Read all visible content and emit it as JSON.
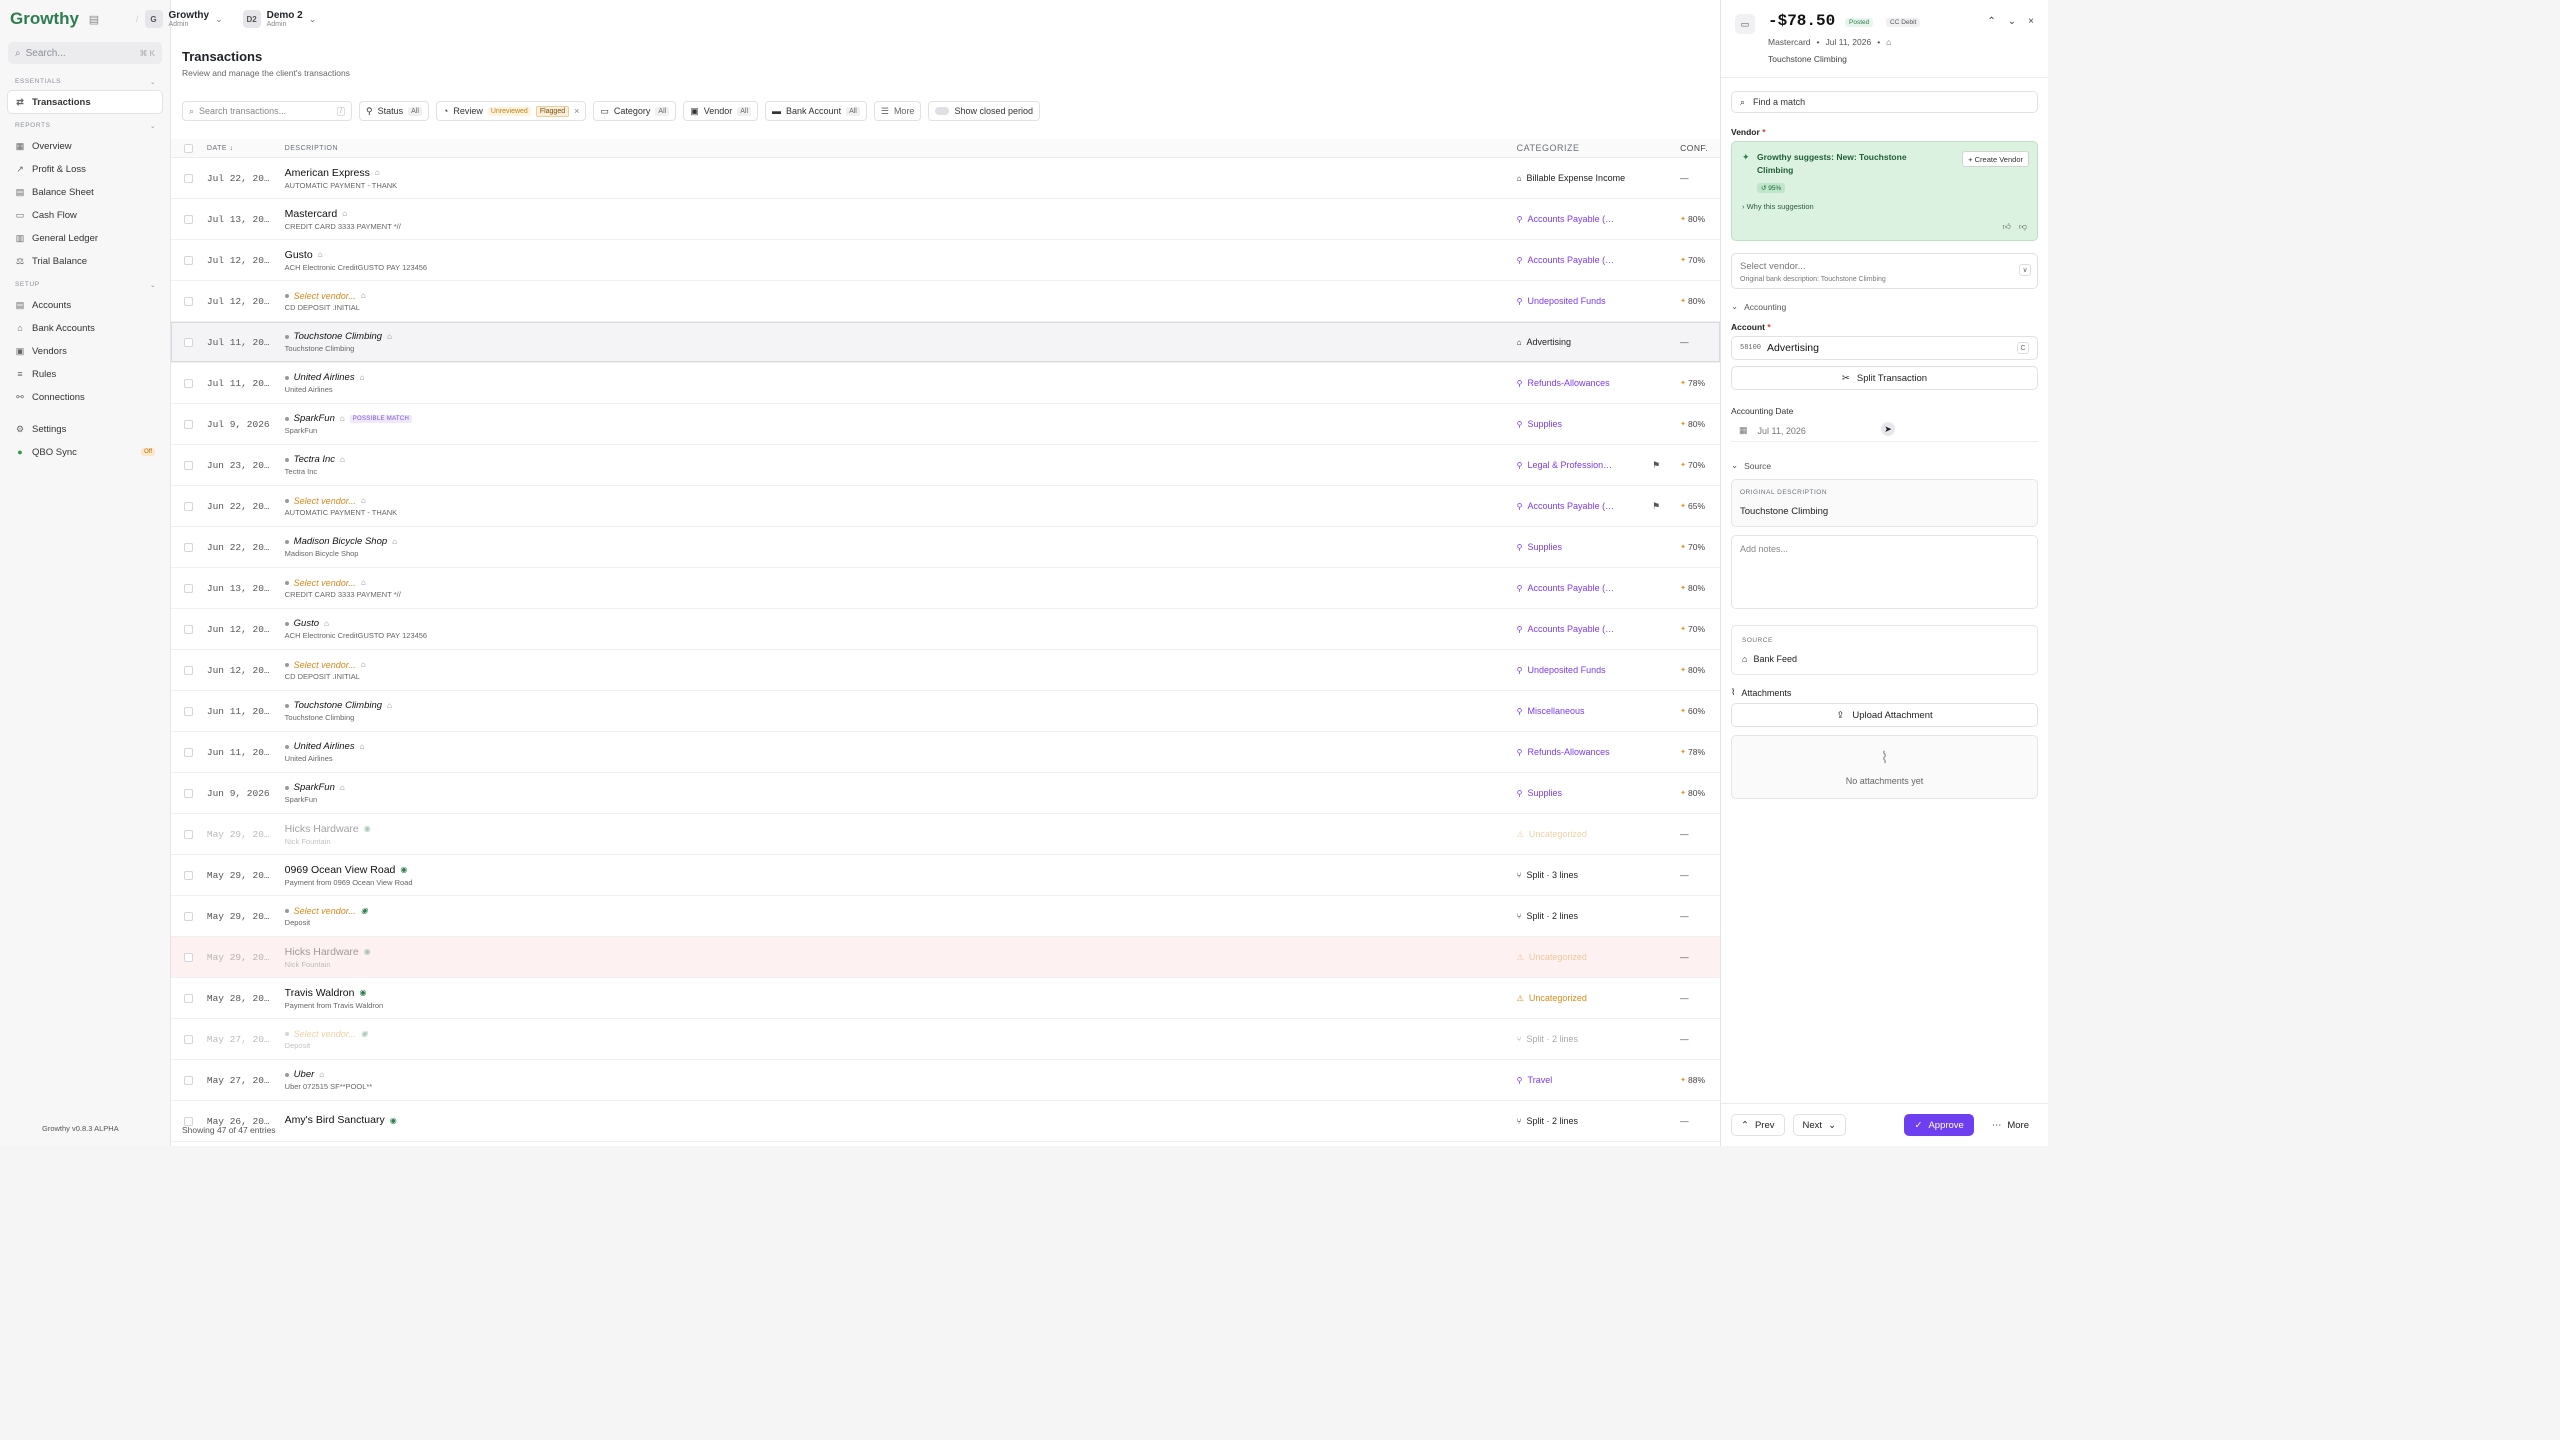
{
  "sidebar": {
    "logo": "Growthy",
    "search_placeholder": "Search...",
    "search_kbd": "⌘ K",
    "essentials_label": "ESSENTIALS",
    "reports_label": "REPORTS",
    "setup_label": "SETUP",
    "essentials": [
      {
        "label": "Transactions",
        "icon": "arrows-icon"
      }
    ],
    "reports": [
      {
        "label": "Overview"
      },
      {
        "label": "Profit & Loss"
      },
      {
        "label": "Balance Sheet"
      },
      {
        "label": "Cash Flow"
      },
      {
        "label": "General Ledger"
      },
      {
        "label": "Trial Balance"
      }
    ],
    "setup": [
      {
        "label": "Accounts"
      },
      {
        "label": "Bank Accounts"
      },
      {
        "label": "Vendors"
      },
      {
        "label": "Rules"
      },
      {
        "label": "Connections"
      }
    ],
    "settings": "Settings",
    "qbo": "QBO Sync",
    "qbo_badge": "Off",
    "version": "Growthy v0.8.3 ALPHA"
  },
  "topbar": {
    "org1_initial": "G",
    "org1_name": "Growthy",
    "org1_role": "Admin",
    "org2_initial": "D2",
    "org2_name": "Demo 2",
    "org2_role": "Admin"
  },
  "page": {
    "title": "Transactions",
    "subtitle": "Review and manage the client's transactions"
  },
  "filters": {
    "search_placeholder": "Search transactions...",
    "search_kbd": "/",
    "status": "Status",
    "status_val": "All",
    "review": "Review",
    "review_unreviewed": "Unreviewed",
    "review_flagged": "Flagged",
    "category": "Category",
    "category_val": "All",
    "vendor": "Vendor",
    "vendor_val": "All",
    "bank_account": "Bank Account",
    "bank_account_val": "All",
    "more": "More",
    "show_closed": "Show closed period"
  },
  "table": {
    "headers": {
      "date": "DATE ↓",
      "description": "DESCRIPTION",
      "categorize": "CATEGORIZE",
      "conf": "CONF."
    },
    "footer": "Showing 47 of 47 entries",
    "rows": [
      {
        "date": "Jul 22, 20…",
        "vendor": "American Express",
        "sub": "AUTOMATIC PAYMENT - THANK",
        "vstyle": "bold",
        "icon": "bank",
        "cat": "Billable Expense Income",
        "cstyle": "plain",
        "cicon": "tag",
        "conf": "—"
      },
      {
        "date": "Jul 13, 20…",
        "vendor": "Mastercard",
        "sub": "CREDIT CARD 3333 PAYMENT *//",
        "vstyle": "bold",
        "icon": "bank",
        "cat": "Accounts Payable (…",
        "cstyle": "link",
        "cicon": "wand",
        "conf": "80%"
      },
      {
        "date": "Jul 12, 20…",
        "vendor": "Gusto",
        "sub": "ACH Electronic CreditGUSTO PAY 123456",
        "vstyle": "bold",
        "icon": "bank",
        "cat": "Accounts Payable (…",
        "cstyle": "link",
        "cicon": "wand",
        "conf": "70%"
      },
      {
        "date": "Jul 12, 20…",
        "vendor": "Select vendor...",
        "sub": "CD DEPOSIT .INITIAL",
        "vstyle": "select",
        "icon": "bank",
        "cat": "Undeposited Funds",
        "cstyle": "link",
        "cicon": "wand",
        "conf": "80%"
      },
      {
        "date": "Jul 11, 20…",
        "vendor": "Touchstone Climbing",
        "sub": "Touchstone Climbing",
        "vstyle": "italic",
        "icon": "bank",
        "cat": "Advertising",
        "cstyle": "plain",
        "cicon": "tag",
        "conf": "—",
        "selected": true
      },
      {
        "date": "Jul 11, 20…",
        "vendor": "United Airlines",
        "sub": "United Airlines",
        "vstyle": "italic",
        "icon": "bank",
        "cat": "Refunds-Allowances",
        "cstyle": "link",
        "cicon": "wand",
        "conf": "78%"
      },
      {
        "date": "Jul 9, 2026",
        "vendor": "SparkFun",
        "sub": "SparkFun",
        "vstyle": "italic",
        "icon": "bank",
        "pm": "POSSIBLE MATCH",
        "cat": "Supplies",
        "cstyle": "link",
        "cicon": "wand",
        "conf": "80%"
      },
      {
        "date": "Jun 23, 20…",
        "vendor": "Tectra Inc",
        "sub": "Tectra Inc",
        "vstyle": "italic",
        "icon": "bank",
        "cat": "Legal & Profession…",
        "cstyle": "link",
        "cicon": "wand",
        "conf": "70%",
        "rule": true
      },
      {
        "date": "Jun 22, 20…",
        "vendor": "Select vendor...",
        "sub": "AUTOMATIC PAYMENT - THANK",
        "vstyle": "select",
        "icon": "bank",
        "cat": "Accounts Payable (…",
        "cstyle": "link",
        "cicon": "wand",
        "conf": "65%",
        "rule": true
      },
      {
        "date": "Jun 22, 20…",
        "vendor": "Madison Bicycle Shop",
        "sub": "Madison Bicycle Shop",
        "vstyle": "italic",
        "icon": "bank",
        "cat": "Supplies",
        "cstyle": "link",
        "cicon": "wand",
        "conf": "70%"
      },
      {
        "date": "Jun 13, 20…",
        "vendor": "Select vendor...",
        "sub": "CREDIT CARD 3333 PAYMENT *//",
        "vstyle": "select",
        "icon": "bank",
        "cat": "Accounts Payable (…",
        "cstyle": "link",
        "cicon": "wand",
        "conf": "80%"
      },
      {
        "date": "Jun 12, 20…",
        "vendor": "Gusto",
        "sub": "ACH Electronic CreditGUSTO PAY 123456",
        "vstyle": "italic",
        "icon": "bank",
        "cat": "Accounts Payable (…",
        "cstyle": "link",
        "cicon": "wand",
        "conf": "70%"
      },
      {
        "date": "Jun 12, 20…",
        "vendor": "Select vendor...",
        "sub": "CD DEPOSIT .INITIAL",
        "vstyle": "select",
        "icon": "bank",
        "cat": "Undeposited Funds",
        "cstyle": "link",
        "cicon": "wand",
        "conf": "80%"
      },
      {
        "date": "Jun 11, 20…",
        "vendor": "Touchstone Climbing",
        "sub": "Touchstone Climbing",
        "vstyle": "italic",
        "icon": "bank",
        "cat": "Miscellaneous",
        "cstyle": "link",
        "cicon": "wand",
        "conf": "60%"
      },
      {
        "date": "Jun 11, 20…",
        "vendor": "United Airlines",
        "sub": "United Airlines",
        "vstyle": "italic",
        "icon": "bank",
        "cat": "Refunds-Allowances",
        "cstyle": "link",
        "cicon": "wand",
        "conf": "78%"
      },
      {
        "date": "Jun 9, 2026",
        "vendor": "SparkFun",
        "sub": "SparkFun",
        "vstyle": "italic",
        "icon": "bank",
        "cat": "Supplies",
        "cstyle": "link",
        "cicon": "wand",
        "conf": "80%"
      },
      {
        "date": "May 29, 20…",
        "vendor": "Hicks Hardware",
        "sub": "Nick Fountain",
        "vstyle": "bold",
        "icon": "globe",
        "cat": "Uncategorized",
        "cstyle": "uncat",
        "cicon": "warn",
        "conf": "—",
        "faded": true
      },
      {
        "date": "May 29, 20…",
        "vendor": "0969 Ocean View Road",
        "sub": "Payment from 0969 Ocean View Road",
        "vstyle": "bold",
        "icon": "globe",
        "cat": "Split · 3 lines",
        "cstyle": "plain",
        "cicon": "split",
        "conf": "—"
      },
      {
        "date": "May 29, 20…",
        "vendor": "Select vendor...",
        "sub": "Deposit",
        "vstyle": "select",
        "icon": "globe",
        "cat": "Split · 2 lines",
        "cstyle": "plain",
        "cicon": "split",
        "conf": "—"
      },
      {
        "date": "May 29, 20…",
        "vendor": "Hicks Hardware",
        "sub": "Nick Fountain",
        "vstyle": "bold",
        "icon": "globe",
        "cat": "Uncategorized",
        "cstyle": "uncat",
        "cicon": "warn",
        "conf": "—",
        "faded": true,
        "flagged": true
      },
      {
        "date": "May 28, 20…",
        "vendor": "Travis Waldron",
        "sub": "Payment from Travis Waldron",
        "vstyle": "bold",
        "icon": "globe",
        "cat": "Uncategorized",
        "cstyle": "uncat",
        "cicon": "warn",
        "conf": "—"
      },
      {
        "date": "May 27, 20…",
        "vendor": "Select vendor...",
        "sub": "Deposit",
        "vstyle": "select",
        "icon": "globe",
        "cat": "Split · 2 lines",
        "cstyle": "plain",
        "cicon": "split",
        "conf": "—",
        "faded": true
      },
      {
        "date": "May 27, 20…",
        "vendor": "Uber",
        "sub": "Uber 072515 SF**POOL**",
        "vstyle": "italic",
        "icon": "bank",
        "cat": "Travel",
        "cstyle": "link",
        "cicon": "wand",
        "conf": "88%"
      },
      {
        "date": "May 26, 20…",
        "vendor": "Amy's Bird Sanctuary",
        "sub": "",
        "vstyle": "bold",
        "icon": "globe",
        "cat": "Split · 2 lines",
        "cstyle": "plain",
        "cicon": "split",
        "conf": "—"
      }
    ]
  },
  "panel": {
    "amount": "-$78.50",
    "posted": "Posted",
    "type": "CC Debit",
    "account": "Mastercard",
    "date": "Jul 11, 2026",
    "vendor_name": "Touchstone Climbing",
    "find_match": "Find a match",
    "vendor_label": "Vendor",
    "suggest_text": "Growthy suggests: New: Touchstone Climbing",
    "suggest_pct": "↺ 95%",
    "why": "Why this suggestion",
    "create_vendor": "+ Create Vendor",
    "select_vendor": "Select vendor...",
    "orig_bank_desc": "Original bank description: Touchstone Climbing",
    "accounting": "Accounting",
    "account_label": "Account",
    "account_num": "58100",
    "account_name": "Advertising",
    "account_key": "C",
    "split": "Split Transaction",
    "acct_date_label": "Accounting Date",
    "acct_date": "Jul 11, 2026",
    "source": "Source",
    "orig_desc_h": "ORIGINAL DESCRIPTION",
    "orig_desc_v": "Touchstone Climbing",
    "notes_placeholder": "Add notes...",
    "source_h": "SOURCE",
    "source_v": "Bank Feed",
    "attachments": "Attachments",
    "upload": "Upload Attachment",
    "no_attach": "No attachments yet",
    "prev": "Prev",
    "next": "Next",
    "approve": "Approve",
    "more": "More"
  }
}
